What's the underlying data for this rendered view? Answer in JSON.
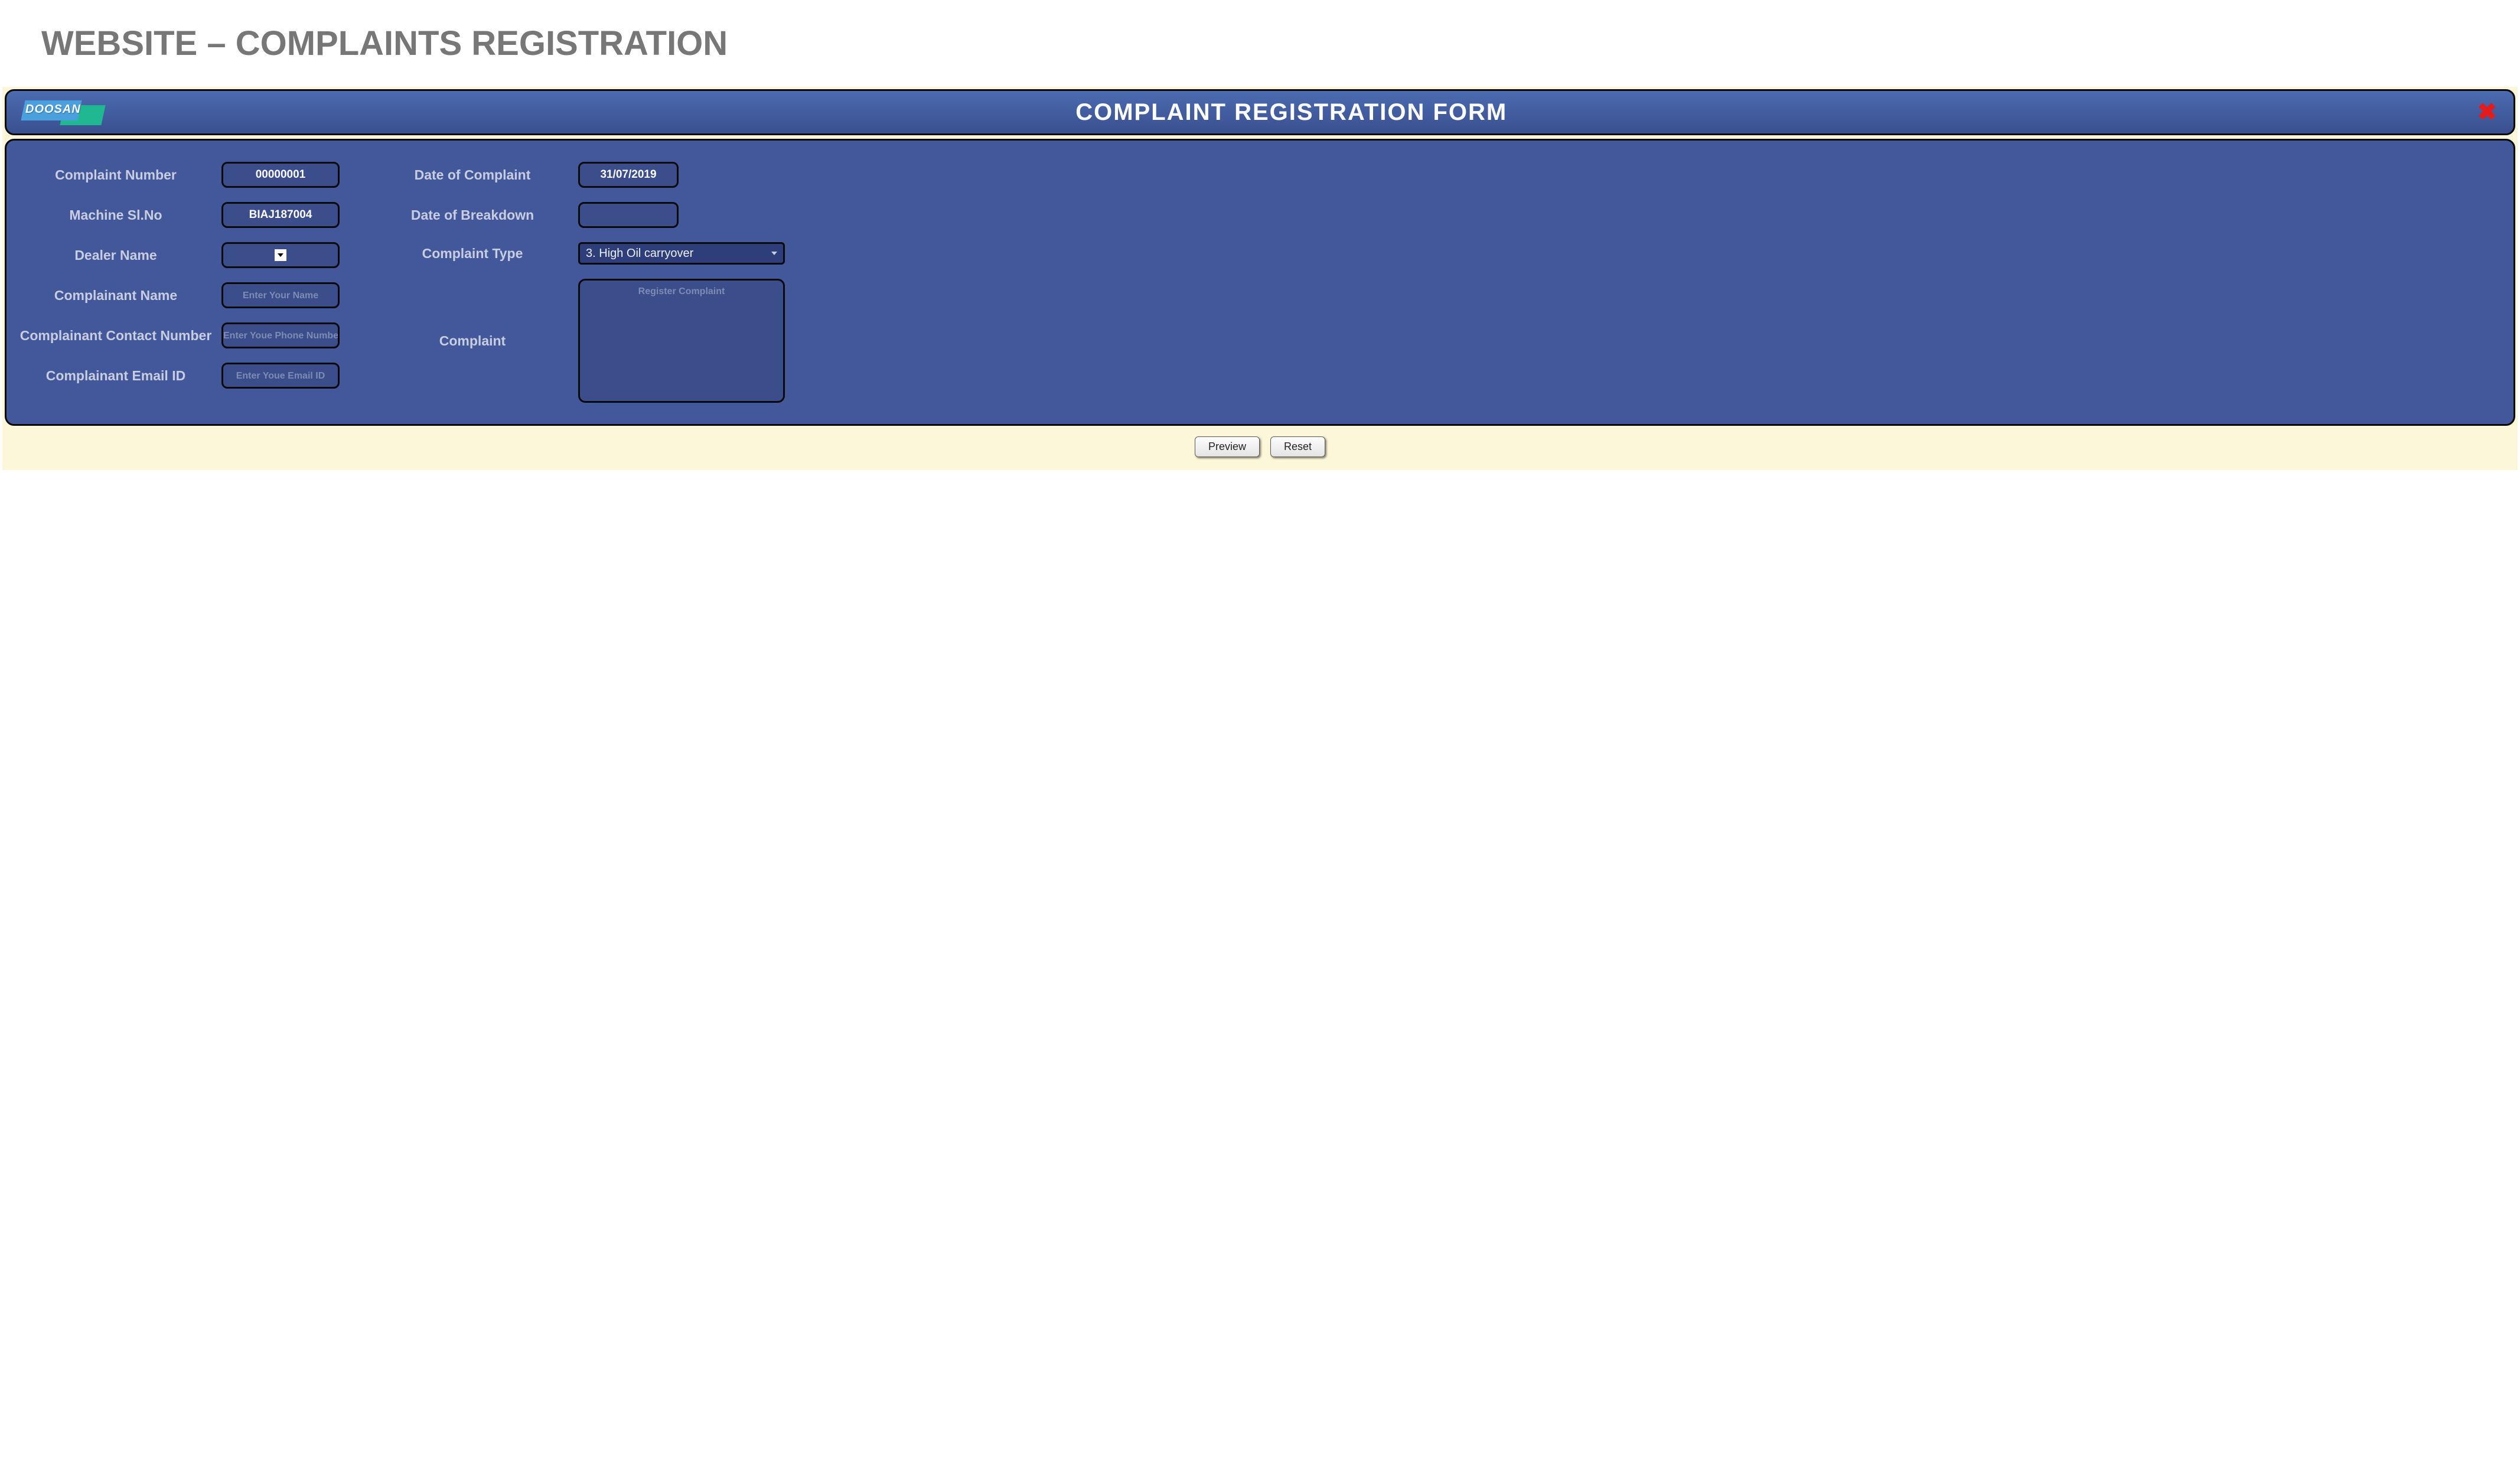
{
  "page": {
    "heading": "WEBSITE – COMPLAINTS REGISTRATION"
  },
  "header": {
    "logo_text": "DOOSAN",
    "title": "COMPLAINT REGISTRATION FORM"
  },
  "fields_left": {
    "complaint_number": {
      "label": "Complaint Number",
      "value": "00000001"
    },
    "machine_slno": {
      "label": "Machine Sl.No",
      "value": "BIAJ187004"
    },
    "dealer_name": {
      "label": "Dealer Name",
      "value": ""
    },
    "complainant_name": {
      "label": "Complainant Name",
      "placeholder": "Enter Your Name",
      "value": ""
    },
    "complainant_contact": {
      "label": "Complainant Contact Number",
      "placeholder": "Enter Youe Phone Number",
      "value": ""
    },
    "complainant_email": {
      "label": "Complainant Email ID",
      "placeholder": "Enter Youe Email ID",
      "value": ""
    }
  },
  "fields_right": {
    "date_of_complaint": {
      "label": "Date of Complaint",
      "value": "31/07/2019"
    },
    "date_of_breakdown": {
      "label": "Date of Breakdown",
      "value": ""
    },
    "complaint_type": {
      "label": "Complaint Type",
      "value": "3. High Oil carryover"
    },
    "complaint": {
      "label": "Complaint",
      "placeholder": "Register Complaint",
      "value": ""
    }
  },
  "buttons": {
    "preview": "Preview",
    "reset": "Reset"
  }
}
